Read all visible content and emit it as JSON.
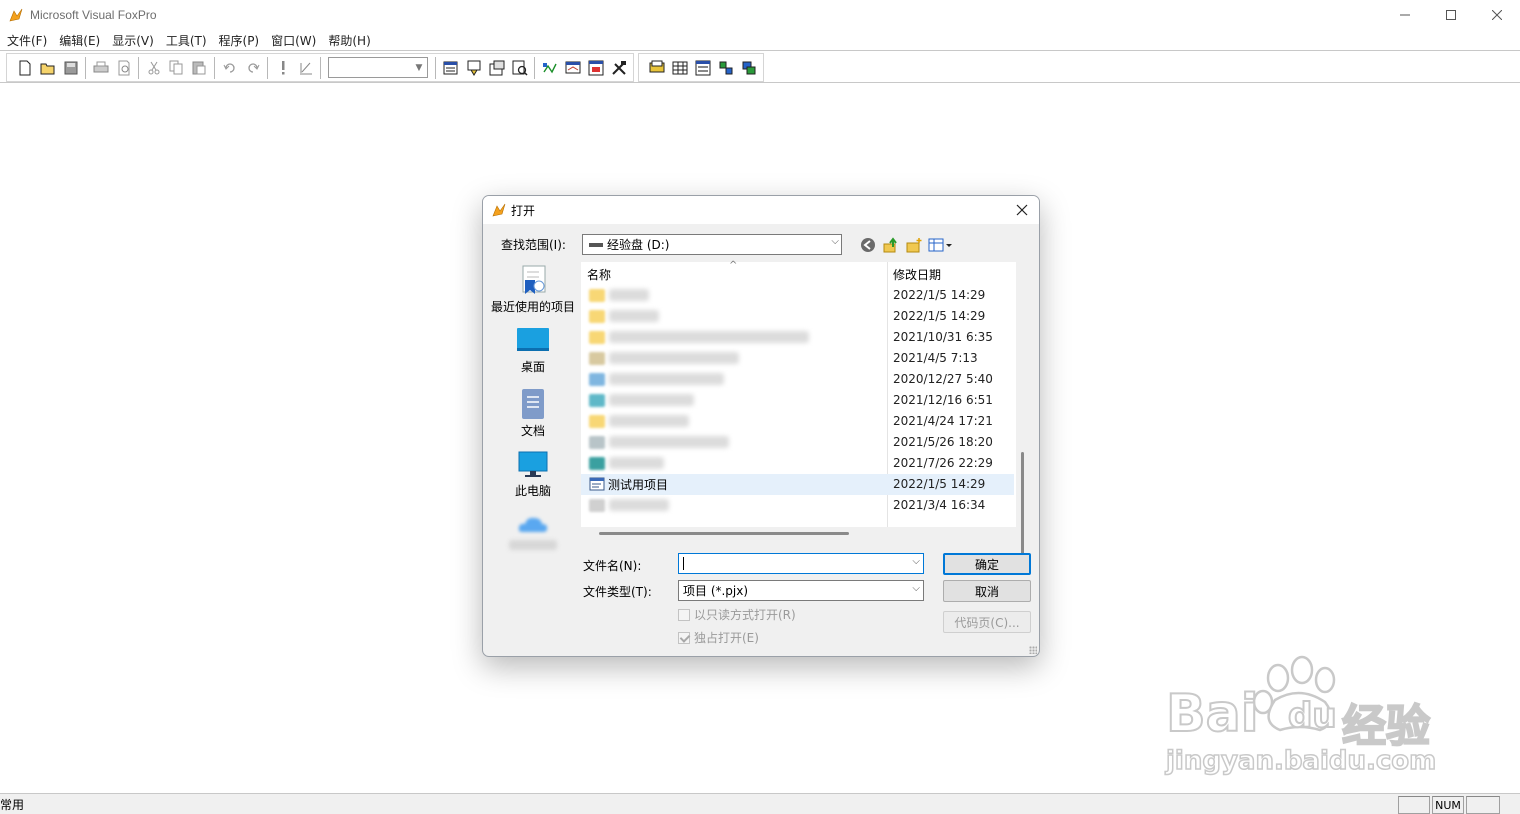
{
  "window": {
    "title": "Microsoft Visual FoxPro",
    "controls": [
      "minimize",
      "maximize",
      "close"
    ]
  },
  "menubar": {
    "items": [
      {
        "label": "文件(F)"
      },
      {
        "label": "编辑(E)"
      },
      {
        "label": "显示(V)"
      },
      {
        "label": "工具(T)"
      },
      {
        "label": "程序(P)"
      },
      {
        "label": "窗口(W)"
      },
      {
        "label": "帮助(H)"
      }
    ]
  },
  "toolbar": {
    "buttons": [
      "new-icon",
      "open-icon",
      "save-icon",
      "print-icon",
      "print-preview-icon",
      "cut-icon",
      "copy-icon",
      "paste-icon",
      "undo-icon",
      "redo-icon",
      "run-icon",
      "modify-form-icon",
      "database-combo",
      "command-window-icon",
      "data-session-icon",
      "properties-icon",
      "code-window-icon",
      "form-designer-icon",
      "report-designer-icon",
      "form-wizard-icon",
      "toolbox-icon",
      "table-wizard-icon",
      "grid-icon",
      "form-icon",
      "connect-icon",
      "remote-view-icon"
    ],
    "database_combo_value": ""
  },
  "statusbar": {
    "text": "常用",
    "cells": [
      "",
      "NUM",
      ""
    ]
  },
  "dialog": {
    "title": "打开",
    "lookin_label": "查找范围(I):",
    "lookin_value": "经验盘 (D:)",
    "places": [
      {
        "label": "最近使用的项目",
        "icon": "recent-items-icon"
      },
      {
        "label": "桌面",
        "icon": "desktop-icon"
      },
      {
        "label": "文档",
        "icon": "documents-icon"
      },
      {
        "label": "此电脑",
        "icon": "this-pc-icon"
      },
      {
        "label": "",
        "icon": "onedrive-icon"
      }
    ],
    "columns": {
      "name": "名称",
      "date": "修改日期"
    },
    "files": [
      {
        "name": "",
        "date": "2022/1/5 14:29",
        "kind": "folder"
      },
      {
        "name": "",
        "date": "2022/1/5 14:29",
        "kind": "folder"
      },
      {
        "name": "",
        "date": "2021/10/31 6:35",
        "kind": "folder"
      },
      {
        "name": "",
        "date": "2021/4/5 7:13",
        "kind": "folder"
      },
      {
        "name": "",
        "date": "2020/12/27 5:40",
        "kind": "file"
      },
      {
        "name": "",
        "date": "2021/12/16 6:51",
        "kind": "file"
      },
      {
        "name": "",
        "date": "2021/4/24 17:21",
        "kind": "folder"
      },
      {
        "name": "",
        "date": "2021/5/26 18:20",
        "kind": "file"
      },
      {
        "name": "",
        "date": "2021/7/26 22:29",
        "kind": "file"
      },
      {
        "name": "测试用项目",
        "date": "2022/1/5 14:29",
        "kind": "project",
        "selected": true
      },
      {
        "name": "",
        "date": "2021/3/4 16:34",
        "kind": "file"
      }
    ],
    "filename_label": "文件名(N):",
    "filename_value": "",
    "filetype_label": "文件类型(T):",
    "filetype_value": "项目 (*.pjx)",
    "ok_label": "确定",
    "cancel_label": "取消",
    "codepage_label": "代码页(C)...",
    "readonly_label": "以只读方式打开(R)",
    "readonly_checked": false,
    "exclusive_label": "独占打开(E)",
    "exclusive_checked": true
  },
  "watermark": {
    "brand_text": "Bai",
    "brand_du": "du",
    "brand_cn": "经验",
    "url": "jingyan.baidu.com"
  }
}
